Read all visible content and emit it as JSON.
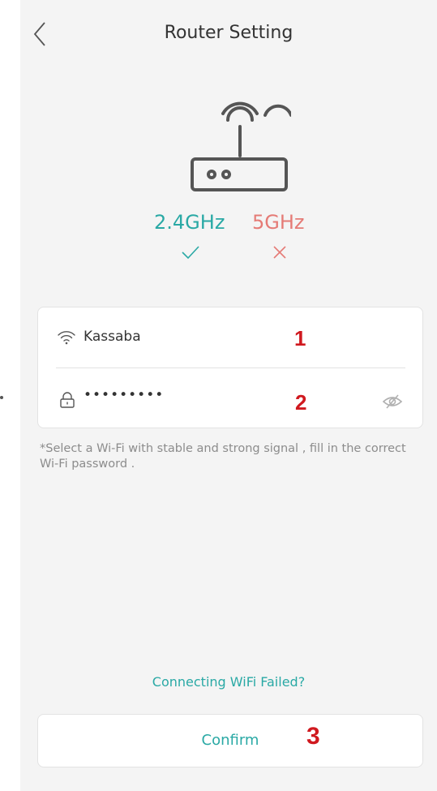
{
  "header": {
    "title": "Router Setting",
    "back_icon": "chevron-left-icon"
  },
  "router": {
    "icon": "router-icon",
    "band_24_label": "2.4GHz",
    "band_5_label": "5GHz",
    "band_24_status": "check-icon",
    "band_5_status": "cross-icon",
    "colors": {
      "supported": "#2aa9a5",
      "unsupported": "#e57b76"
    }
  },
  "form": {
    "ssid_icon": "wifi-icon",
    "ssid_value": "Kassaba",
    "password_icon": "lock-icon",
    "password_value": "•••••••••",
    "toggle_icon": "eye-off-icon"
  },
  "annotations": {
    "marker_1": "1",
    "marker_2": "2",
    "marker_3": "3",
    "color": "#d0191f"
  },
  "hint": "*Select a Wi-Fi with stable and strong signal , fill in the correct Wi-Fi password .",
  "help_link": "Connecting WiFi Failed?",
  "confirm_label": "Confirm"
}
